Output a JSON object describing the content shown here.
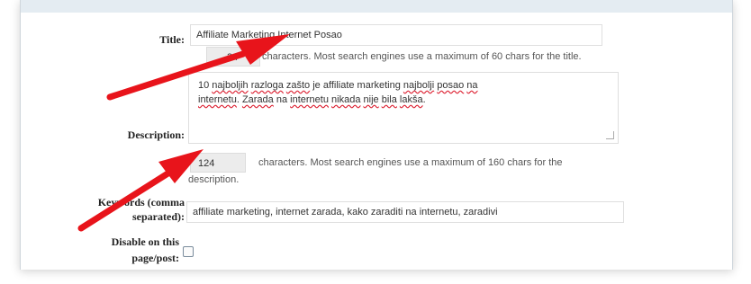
{
  "title_field": {
    "label": "Title:",
    "value": "Affiliate Marketing Internet Posao",
    "count": "34",
    "help": "characters. Most search engines use a maximum of 60 chars for the title."
  },
  "description_field": {
    "label": "Description:",
    "line1_before": "10 ",
    "line1_w1": "najboljih",
    "line1_sp1": " ",
    "line1_w2": "razloga",
    "line1_sp2": " ",
    "line1_w3": "zašto",
    "line1_mid": " je affiliate marketing ",
    "line1_w4": "najbolji",
    "line1_sp3": " ",
    "line1_w5": "posao",
    "line1_sp4": " ",
    "line1_w6": "na",
    "line2_w1": "internetu",
    "line2_dot": ". ",
    "line2_w2": "Zarada",
    "line2_sp1": " na ",
    "line2_w3": "internetu",
    "line2_sp2": " ",
    "line2_w4": "nikada",
    "line2_sp3": " ",
    "line2_w5": "nije",
    "line2_sp4": " ",
    "line2_w6": "bila",
    "line2_sp5": " ",
    "line2_w7": "lakša",
    "line2_end": ".",
    "count": "124",
    "help_line1": "characters. Most search engines use a maximum of 160 chars for the",
    "help_line2": "description."
  },
  "keywords_field": {
    "label_line1": "Keywords (comma",
    "label_line2": "separated):",
    "value": "affiliate marketing, internet zarada, kako zaraditi na internetu, zaradivi"
  },
  "disable_field": {
    "label_line1": "Disable on this",
    "label_line2": "page/post:",
    "checked": false
  },
  "colors": {
    "arrow": "#e8141b",
    "panel_bg": "#ffffff",
    "top_band": "#e4ecf2"
  }
}
